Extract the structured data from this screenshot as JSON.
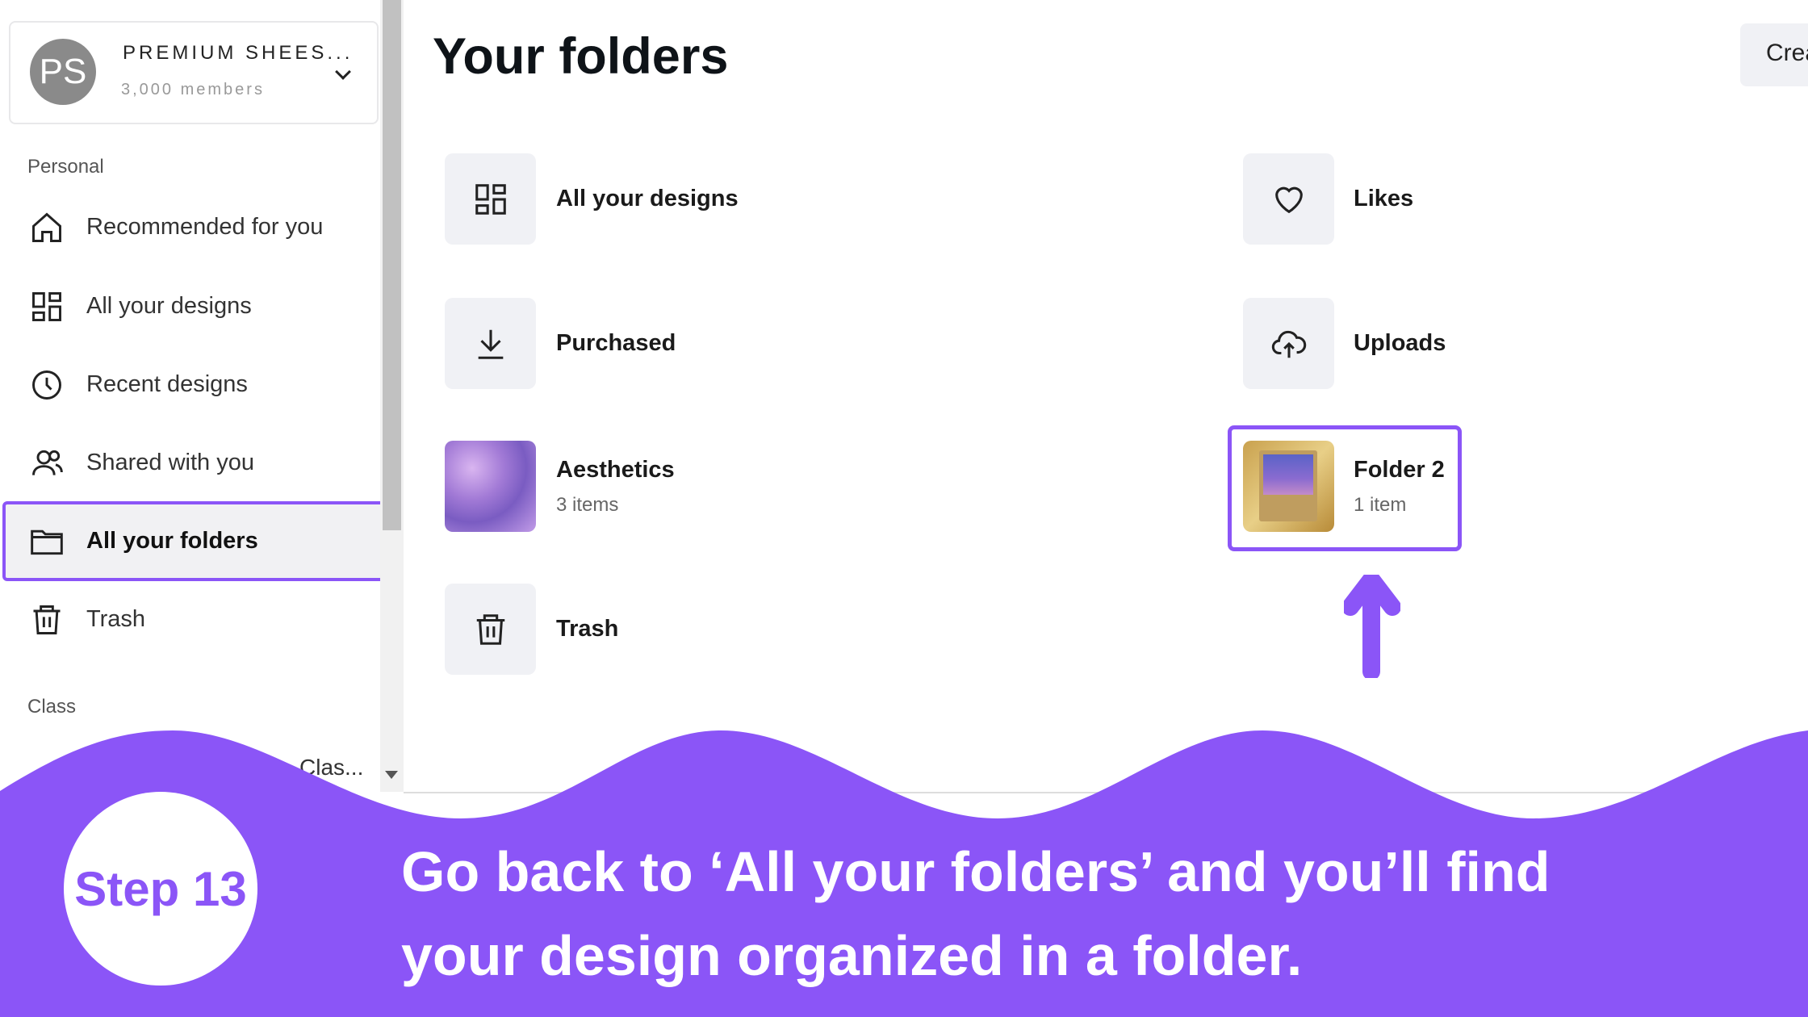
{
  "account": {
    "initials": "PS",
    "name": "PREMIUM SHEES...",
    "members": "3,000 members"
  },
  "sidebar": {
    "personal_label": "Personal",
    "items": [
      {
        "label": "Recommended for you",
        "icon": "home-icon"
      },
      {
        "label": "All your designs",
        "icon": "grid-icon"
      },
      {
        "label": "Recent designs",
        "icon": "clock-icon"
      },
      {
        "label": "Shared with you",
        "icon": "people-icon"
      },
      {
        "label": "All your folders",
        "icon": "folder-icon",
        "selected": true
      },
      {
        "label": "Trash",
        "icon": "trash-icon"
      }
    ],
    "class_label": "Class",
    "class_item": "Clas..."
  },
  "main": {
    "title": "Your folders",
    "create_label": "Crea",
    "folders": [
      {
        "label": "All your designs",
        "icon": "grid-icon"
      },
      {
        "label": "Likes",
        "icon": "heart-icon"
      },
      {
        "label": "Purchased",
        "icon": "download-icon"
      },
      {
        "label": "Uploads",
        "icon": "cloud-upload-icon"
      },
      {
        "label": "Aesthetics",
        "count": "3 items"
      },
      {
        "label": "Folder 2",
        "count": "1 item",
        "highlighted": true
      },
      {
        "label": "Trash",
        "icon": "trash-icon"
      }
    ]
  },
  "overlay": {
    "step": "Step 13",
    "caption_line1": "Go back to ‘All your folders’ and you’ll find",
    "caption_line2": "your design organized in a folder.",
    "accent": "#8b55f7"
  }
}
